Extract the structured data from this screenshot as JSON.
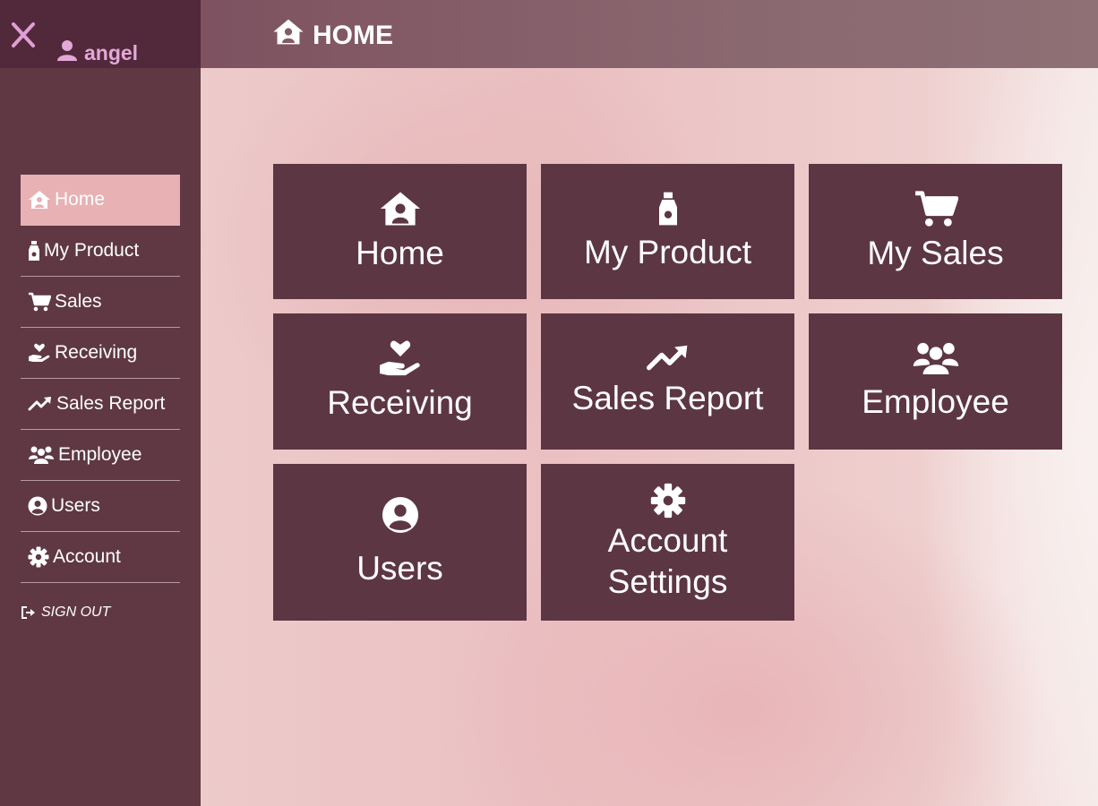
{
  "sidebar": {
    "username": "angel",
    "items": [
      {
        "label": "Home",
        "icon": "house-user-icon",
        "active": true
      },
      {
        "label": "My Product",
        "icon": "bottle-icon",
        "active": false
      },
      {
        "label": "Sales",
        "icon": "cart-icon",
        "active": false
      },
      {
        "label": "Receiving",
        "icon": "hand-holding-heart-icon",
        "active": false
      },
      {
        "label": "Sales Report",
        "icon": "chart-line-icon",
        "active": false
      },
      {
        "label": "Employee",
        "icon": "users-icon",
        "active": false
      },
      {
        "label": "Users",
        "icon": "user-circle-icon",
        "active": false
      },
      {
        "label": "Account",
        "icon": "gear-icon",
        "active": false
      }
    ],
    "signout_label": "SIGN OUT"
  },
  "header": {
    "title": "HOME"
  },
  "tiles": [
    {
      "label": "Home",
      "icon": "house-user-icon"
    },
    {
      "label": "My Product",
      "icon": "bottle-icon"
    },
    {
      "label": "My Sales",
      "icon": "cart-icon"
    },
    {
      "label": "Receiving",
      "icon": "hand-holding-heart-icon"
    },
    {
      "label": "Sales Report",
      "icon": "chart-line-icon"
    },
    {
      "label": "Employee",
      "icon": "users-icon"
    },
    {
      "label": "Users",
      "icon": "user-circle-icon"
    },
    {
      "label_line1": "Account",
      "label_line2": "Settings",
      "icon": "gear-icon"
    }
  ],
  "colors": {
    "sidebar_bg": "#5f3844",
    "sidebar_top_bg": "#52293a",
    "active_item_bg": "#e8b1b4",
    "tile_bg": "#5d3643",
    "username_color": "#e3a8d8",
    "close_icon_color": "#df9fd6"
  }
}
